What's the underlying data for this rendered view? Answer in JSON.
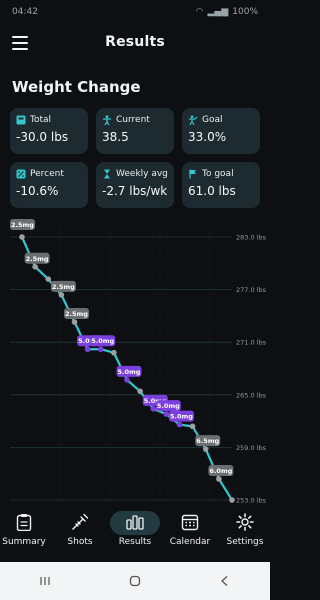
{
  "status": {
    "time": "04:42",
    "battery": "100%"
  },
  "appbar": {
    "title": "Results",
    "menu_icon": "hamburger-menu-icon"
  },
  "section": {
    "title": "Weight Change"
  },
  "cards": [
    {
      "label": "Total",
      "value": "-30.0 lbs",
      "icon": "scale-icon"
    },
    {
      "label": "Current",
      "value": "38.5",
      "icon": "person-icon"
    },
    {
      "label": "Goal",
      "value": "33.0%",
      "icon": "target-person-icon"
    },
    {
      "label": "Percent",
      "value": "-10.6%",
      "icon": "percent-icon"
    },
    {
      "label": "Weekly avg",
      "value": "-2.7 lbs/wk",
      "icon": "hourglass-icon"
    },
    {
      "label": "To goal",
      "value": "61.0 lbs",
      "icon": "flag-icon"
    }
  ],
  "colors": {
    "accent": "#33c6cf",
    "card_bg": "#1d2b30",
    "dose_purple": "#7b3fe0",
    "dose_gray": "#6b6e70"
  },
  "chart_data": {
    "type": "line",
    "y_ticks": [
      "283.0 lbs",
      "277.0 lbs",
      "271.0 lbs",
      "265.0 lbs",
      "259.0 lbs",
      "253.0 lbs"
    ],
    "ylim": [
      253,
      283
    ],
    "points": [
      {
        "i": 0,
        "y": 283.0,
        "dose": "2.5mg"
      },
      {
        "i": 1,
        "y": 279.6,
        "dose": "2.5mg"
      },
      {
        "i": 2,
        "y": 278.2,
        "dose": ""
      },
      {
        "i": 3,
        "y": 276.4,
        "dose": "2.5mg"
      },
      {
        "i": 4,
        "y": 273.3,
        "dose": "2.5mg"
      },
      {
        "i": 5,
        "y": 270.2,
        "dose": "5.0mg"
      },
      {
        "i": 6,
        "y": 270.2,
        "dose": "5.0mg"
      },
      {
        "i": 7,
        "y": 269.8,
        "dose": ""
      },
      {
        "i": 8,
        "y": 266.7,
        "dose": "5.0mg"
      },
      {
        "i": 9,
        "y": 265.4,
        "dose": ""
      },
      {
        "i": 10,
        "y": 263.4,
        "dose": "5.0mg"
      },
      {
        "i": 11,
        "y": 262.8,
        "dose": "5.0mg"
      },
      {
        "i": 12,
        "y": 261.6,
        "dose": "5.0mg"
      },
      {
        "i": 13,
        "y": 261.4,
        "dose": ""
      },
      {
        "i": 14,
        "y": 258.8,
        "dose": "6.5mg"
      },
      {
        "i": 15,
        "y": 255.4,
        "dose": "6.0mg"
      },
      {
        "i": 16,
        "y": 253.0,
        "dose": ""
      }
    ]
  },
  "nav": [
    {
      "label": "Summary",
      "icon": "clipboard-icon",
      "active": false
    },
    {
      "label": "Shots",
      "icon": "syringe-icon",
      "active": false
    },
    {
      "label": "Results",
      "icon": "bar-chart-icon",
      "active": true
    },
    {
      "label": "Calendar",
      "icon": "calendar-icon",
      "active": false
    },
    {
      "label": "Settings",
      "icon": "gear-icon",
      "active": false
    }
  ]
}
